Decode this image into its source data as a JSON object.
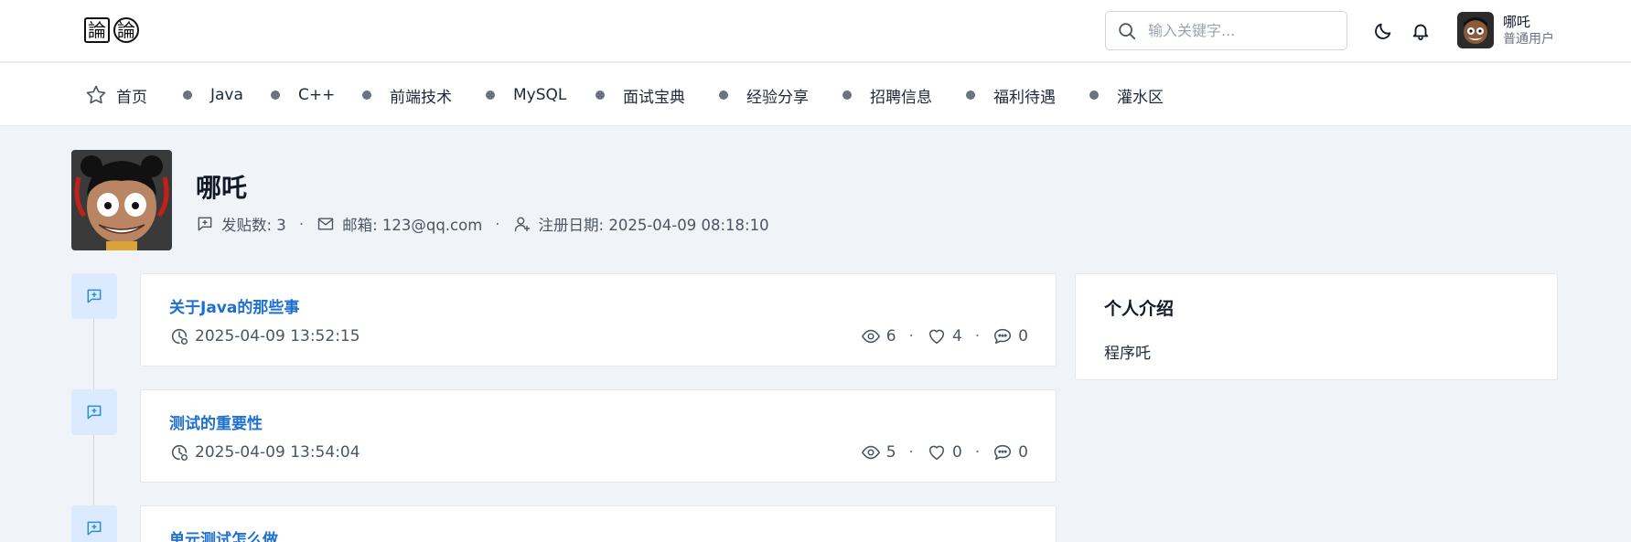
{
  "header": {
    "logo": {
      "glyphs": [
        "論",
        "論"
      ]
    },
    "search": {
      "placeholder": "输入关键字..."
    },
    "user": {
      "name": "哪吒",
      "role": "普通用户"
    }
  },
  "nav": {
    "items": [
      {
        "label": "首页",
        "icon": "star-icon"
      },
      {
        "label": "Java",
        "icon": "dot"
      },
      {
        "label": "C++",
        "icon": "dot"
      },
      {
        "label": "前端技术",
        "icon": "dot"
      },
      {
        "label": "MySQL",
        "icon": "dot"
      },
      {
        "label": "面试宝典",
        "icon": "dot"
      },
      {
        "label": "经验分享",
        "icon": "dot"
      },
      {
        "label": "招聘信息",
        "icon": "dot"
      },
      {
        "label": "福利待遇",
        "icon": "dot"
      },
      {
        "label": "灌水区",
        "icon": "dot"
      }
    ]
  },
  "profile": {
    "name": "哪吒",
    "posts_label": "发贴数: 3",
    "email_label": "邮箱: 123@qq.com",
    "register_label": "注册日期: 2025-04-09 08:18:10",
    "separator": "·"
  },
  "posts": [
    {
      "title": "关于Java的那些事",
      "date": "2025-04-09 13:52:15",
      "views": "6",
      "likes": "4",
      "comments": "0"
    },
    {
      "title": "测试的重要性",
      "date": "2025-04-09 13:54:04",
      "views": "5",
      "likes": "0",
      "comments": "0"
    },
    {
      "title": "单元测试怎么做"
    }
  ],
  "intro": {
    "title": "个人介绍",
    "text": "程序吒"
  },
  "colors": {
    "accent": "#1d6fd1",
    "background": "#f0f3f7",
    "timeline_icon_bg": "#dbeafe"
  }
}
